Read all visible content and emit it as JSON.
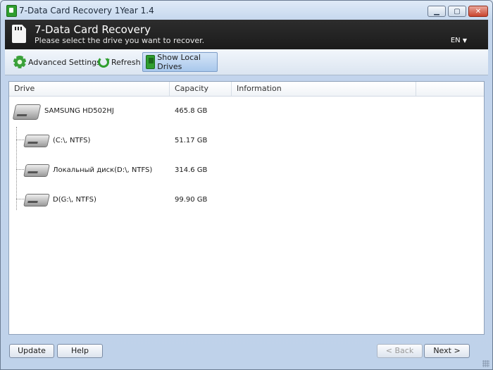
{
  "window": {
    "title": "7-Data Card Recovery 1Year 1.4"
  },
  "header": {
    "title": "7-Data Card Recovery",
    "subtitle": "Please select the drive you want to recover.",
    "language": "EN"
  },
  "toolbar": {
    "advanced_settings": "Advanced Settings",
    "refresh": "Refresh",
    "show_local_drives": "Show Local Drives"
  },
  "table": {
    "columns": [
      "Drive",
      "Capacity",
      "Information"
    ],
    "rows": [
      {
        "name": "SAMSUNG  HD502HJ",
        "capacity": "465.8 GB",
        "info": ""
      },
      {
        "name": "(C:\\, NTFS)",
        "capacity": "51.17 GB",
        "info": ""
      },
      {
        "name": "Локальный диск(D:\\, NTFS)",
        "capacity": "314.6 GB",
        "info": ""
      },
      {
        "name": "D(G:\\, NTFS)",
        "capacity": "99.90 GB",
        "info": ""
      }
    ]
  },
  "footer": {
    "update": "Update",
    "help": "Help",
    "back": "< Back",
    "next": "Next >"
  },
  "colors": {
    "accent_green": "#2f9e2f",
    "header_bg": "#1b1b1b"
  }
}
